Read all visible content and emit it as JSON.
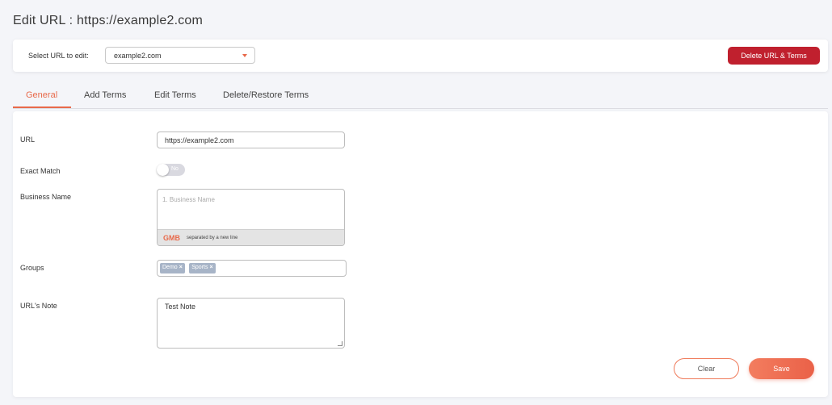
{
  "page": {
    "title": "Edit URL : https://example2.com"
  },
  "url_selector": {
    "label": "Select URL to edit:",
    "selected": "example2.com",
    "delete_button": "Delete URL & Terms"
  },
  "tabs": [
    {
      "label": "General",
      "active": true
    },
    {
      "label": "Add Terms",
      "active": false
    },
    {
      "label": "Edit Terms",
      "active": false
    },
    {
      "label": "Delete/Restore Terms",
      "active": false
    }
  ],
  "form": {
    "url": {
      "label": "URL",
      "value": "https://example2.com"
    },
    "exact_match": {
      "label": "Exact Match",
      "state": "No"
    },
    "business_name": {
      "label": "Business Name",
      "placeholder": "1.  Business Name",
      "badge": "GMB",
      "hint": "separated by a new line"
    },
    "groups": {
      "label": "Groups",
      "chips": [
        {
          "text": "Demo",
          "remove": "×"
        },
        {
          "text": "Sports",
          "remove": "×"
        }
      ]
    },
    "note": {
      "label": "URL's Note",
      "value": "Test Note"
    }
  },
  "actions": {
    "clear": "Clear",
    "save": "Save"
  },
  "colors": {
    "accent": "#e8694a",
    "danger": "#c0202e",
    "chip": "#a7b4c7"
  }
}
